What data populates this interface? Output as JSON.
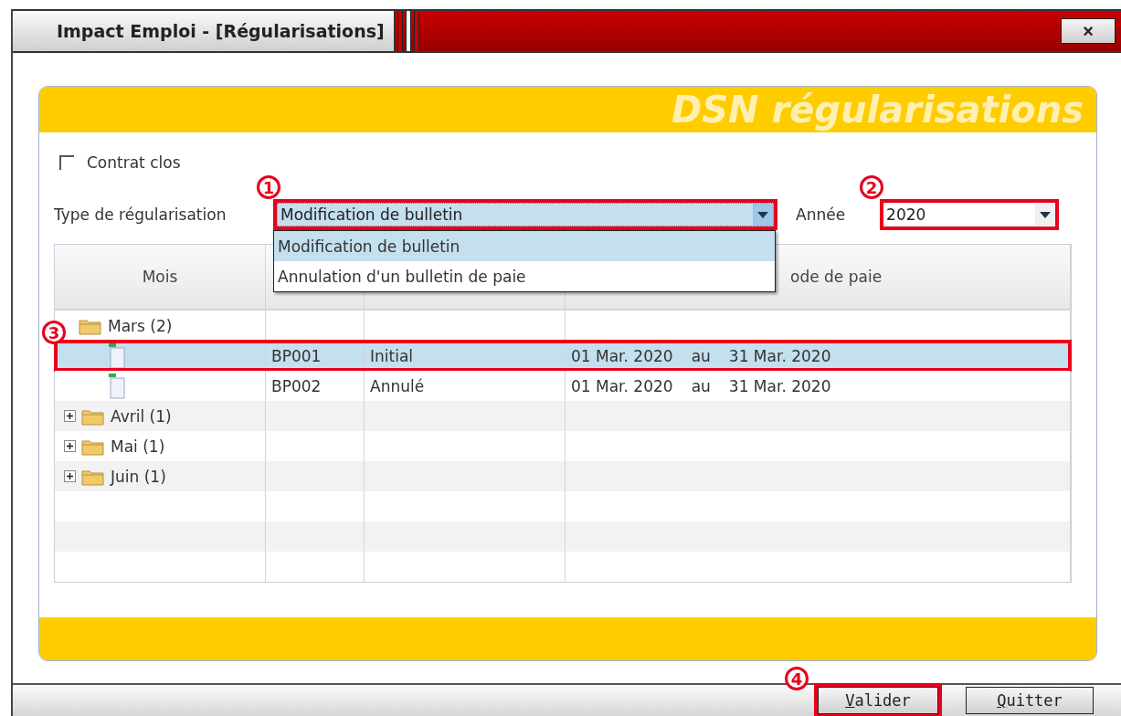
{
  "window": {
    "title": "Impact Emploi - [Régularisations]",
    "close_label": "×"
  },
  "panel": {
    "title": "DSN régularisations"
  },
  "contrat_clos": {
    "label": "Contrat clos",
    "checked": false
  },
  "type_regularisation": {
    "label": "Type de régularisation",
    "value": "Modification de bulletin",
    "annotation": "1",
    "expanded": true,
    "options": [
      {
        "label": "Modification de bulletin",
        "selected": true
      },
      {
        "label": "Annulation d'un bulletin de paie",
        "selected": false
      }
    ]
  },
  "annee": {
    "label": "Année",
    "value": "2020",
    "annotation": "2"
  },
  "table": {
    "columns": [
      "Mois",
      "",
      "",
      "ode de paie"
    ],
    "rows": [
      {
        "month": "Mars (2)",
        "expanded": true,
        "children": [
          {
            "code": "BP001",
            "status": "Initial",
            "from": "01 Mar. 2020",
            "to_word": "au",
            "to": "31 Mar. 2020",
            "selected": true,
            "annotation": "3"
          },
          {
            "code": "BP002",
            "status": "Annulé",
            "from": "01 Mar. 2020",
            "to_word": "au",
            "to": "31 Mar. 2020",
            "selected": false
          }
        ]
      },
      {
        "month": "Avril (1)",
        "expanded": false
      },
      {
        "month": "Mai (1)",
        "expanded": false
      },
      {
        "month": "Juin (1)",
        "expanded": false
      }
    ]
  },
  "buttons": [
    {
      "label": "Valider",
      "annotation": "4"
    },
    {
      "label": "Quitter"
    }
  ]
}
